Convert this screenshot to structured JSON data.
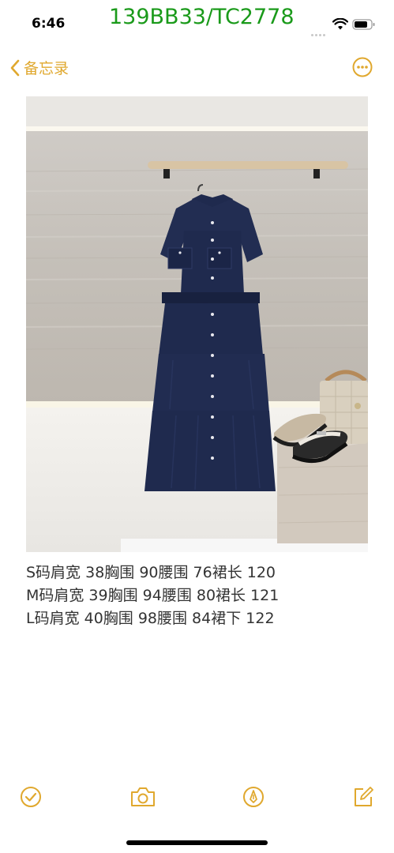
{
  "status": {
    "time": "6:46",
    "watermark": "139BB33/TC2778"
  },
  "nav": {
    "back_label": "备忘录"
  },
  "note": {
    "lines": [
      "S码肩宽 38胸围 90腰围 76裙长 120",
      "M码肩宽 39胸围 94腰围 80裙长 121",
      "L码肩宽 40胸围 98腰围 84裙下 122"
    ]
  },
  "icons": {
    "back": "chevron-left-icon",
    "more": "ellipsis-circle-icon",
    "check": "checkmark-circle-icon",
    "camera": "camera-icon",
    "markup": "pen-tip-icon",
    "compose": "compose-icon"
  },
  "colors": {
    "accent": "#e0a82e",
    "watermark": "#1a9a1a",
    "dress": "#1f2a4e"
  }
}
